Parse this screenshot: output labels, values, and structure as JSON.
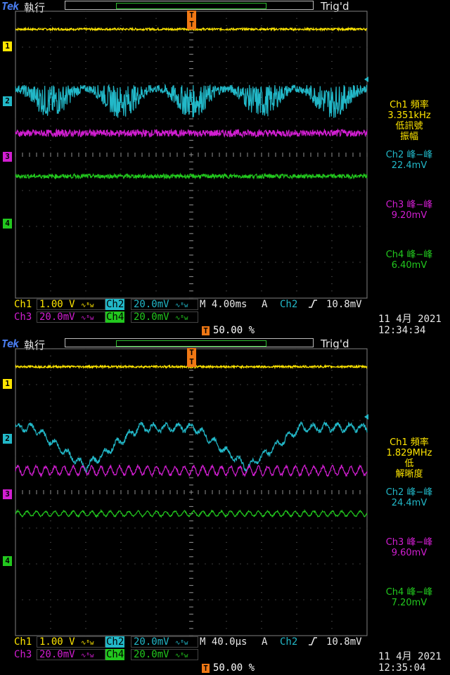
{
  "screens": [
    {
      "brand": "Tek",
      "run_state": "執行",
      "trigger_state": "Trig'd",
      "readouts": [
        {
          "label": "Ch1 頻率",
          "value": "3.351kHz",
          "note1": "低訊號",
          "note2": "振幅",
          "color": "#ffe600"
        },
        {
          "label": "Ch2 峰−峰",
          "value": "22.4mV",
          "color": "#22b8c8"
        },
        {
          "label": "Ch3 峰−峰",
          "value": "9.20mV",
          "color": "#d21ed2"
        },
        {
          "label": "Ch4 峰−峰",
          "value": "6.40mV",
          "color": "#22c81e"
        }
      ],
      "settings": {
        "ch1_label": "Ch1",
        "ch1_scale": "1.00 V",
        "ch2_label": "Ch2",
        "ch2_scale": "20.0mV",
        "ch3_label": "Ch3",
        "ch3_scale": "20.0mV",
        "ch4_label": "Ch4",
        "ch4_scale": "20.0mV",
        "bw_icon": "∿ᴮw",
        "timebase": "M 4.00ms",
        "trigger_mode": "A",
        "trigger_source": "Ch2",
        "trigger_slope_icon": "rising-edge-icon",
        "trigger_level": "10.8mV",
        "trigger_position": "50.00 %"
      },
      "timestamp_date": "11 4月  2021",
      "timestamp_time": "12:34:34",
      "channel_markers": [
        "1",
        "2",
        "3",
        "4"
      ],
      "trigger_marker": "T"
    },
    {
      "brand": "Tek",
      "run_state": "執行",
      "trigger_state": "Trig'd",
      "readouts": [
        {
          "label": "Ch1 頻率",
          "value": "1.829MHz",
          "note1": "低",
          "note2": "解晰度",
          "color": "#ffe600"
        },
        {
          "label": "Ch2 峰−峰",
          "value": "24.4mV",
          "color": "#22b8c8"
        },
        {
          "label": "Ch3 峰−峰",
          "value": "9.60mV",
          "color": "#d21ed2"
        },
        {
          "label": "Ch4 峰−峰",
          "value": "7.20mV",
          "color": "#22c81e"
        }
      ],
      "settings": {
        "ch1_label": "Ch1",
        "ch1_scale": "1.00 V",
        "ch2_label": "Ch2",
        "ch2_scale": "20.0mV",
        "ch3_label": "Ch3",
        "ch3_scale": "20.0mV",
        "ch4_label": "Ch4",
        "ch4_scale": "20.0mV",
        "bw_icon": "∿ᴮw",
        "timebase": "M 40.0µs",
        "trigger_mode": "A",
        "trigger_source": "Ch2",
        "trigger_slope_icon": "rising-edge-icon",
        "trigger_level": "10.8mV",
        "trigger_position": "50.00 %"
      },
      "timestamp_date": "11 4月  2021",
      "timestamp_time": "12:35:04",
      "channel_markers": [
        "1",
        "2",
        "3",
        "4"
      ],
      "trigger_marker": "T"
    }
  ],
  "chart_data": [
    {
      "type": "line",
      "title": "",
      "xdivisions": 10,
      "ydivisions": 8,
      "timebase_per_div": "4.00ms",
      "series": [
        {
          "name": "Ch1",
          "color": "#ffe600",
          "shape": "flat",
          "level_div": 3.5,
          "noise_div": 0.03
        },
        {
          "name": "Ch2",
          "color": "#22b8c8",
          "shape": "modulated-burst",
          "level_div": 1.6,
          "envelope_periods": 5,
          "amp_div": 0.6
        },
        {
          "name": "Ch3",
          "color": "#d21ed2",
          "shape": "noise",
          "level_div": 0.6,
          "noise_div": 0.1
        },
        {
          "name": "Ch4",
          "color": "#22c81e",
          "shape": "flat",
          "level_div": -0.6,
          "noise_div": 0.06
        }
      ]
    },
    {
      "type": "line",
      "title": "",
      "xdivisions": 10,
      "ydivisions": 8,
      "timebase_per_div": "40.0µs",
      "series": [
        {
          "name": "Ch1",
          "color": "#ffe600",
          "shape": "flat",
          "level_div": 3.5,
          "noise_div": 0.03
        },
        {
          "name": "Ch2",
          "color": "#22b8c8",
          "shape": "dips",
          "level_div": 1.8,
          "dip_depth_div": 1.1,
          "dips_at_div": [
            2.0,
            6.6
          ]
        },
        {
          "name": "Ch3",
          "color": "#d21ed2",
          "shape": "ripple",
          "level_div": 0.6,
          "ripple_cycles": 38,
          "amp_div": 0.12
        },
        {
          "name": "Ch4",
          "color": "#22c81e",
          "shape": "ripple",
          "level_div": -0.6,
          "ripple_cycles": 38,
          "amp_div": 0.07
        }
      ]
    }
  ]
}
